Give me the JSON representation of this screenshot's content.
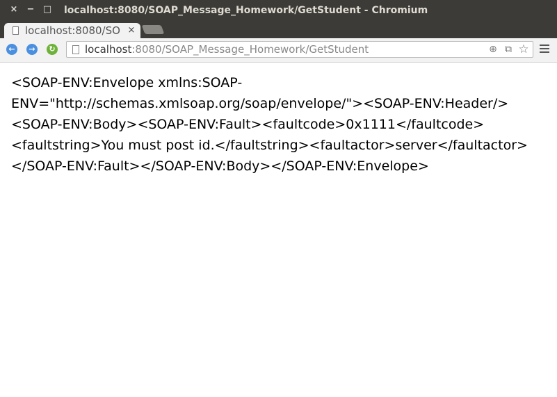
{
  "window": {
    "title": "localhost:8080/SOAP_Message_Homework/GetStudent - Chromium",
    "close_icon": "×",
    "minimize_icon": "−",
    "maximize_icon": "□"
  },
  "tab": {
    "label": "localhost:8080/SO",
    "close_icon": "×"
  },
  "toolbar": {
    "back_icon": "←",
    "forward_icon": "→",
    "reload_icon": "↻"
  },
  "omnibox": {
    "url_host": "localhost",
    "url_rest": ":8080/SOAP_Message_Homework/GetStudent",
    "zoom_icon": "⊕",
    "translate_icon": "⧉",
    "star_icon": "☆"
  },
  "page": {
    "lines": [
      "<SOAP-ENV:Envelope xmlns:SOAP-",
      "ENV=\"http://schemas.xmlsoap.org/soap/envelope/\"><SOAP-ENV:Header/>",
      "<SOAP-ENV:Body><SOAP-ENV:Fault><faultcode>0x1111</faultcode>",
      "<faultstring>You must post id.</faultstring><faultactor>server</faultactor>",
      "</SOAP-ENV:Fault></SOAP-ENV:Body></SOAP-ENV:Envelope>"
    ]
  }
}
